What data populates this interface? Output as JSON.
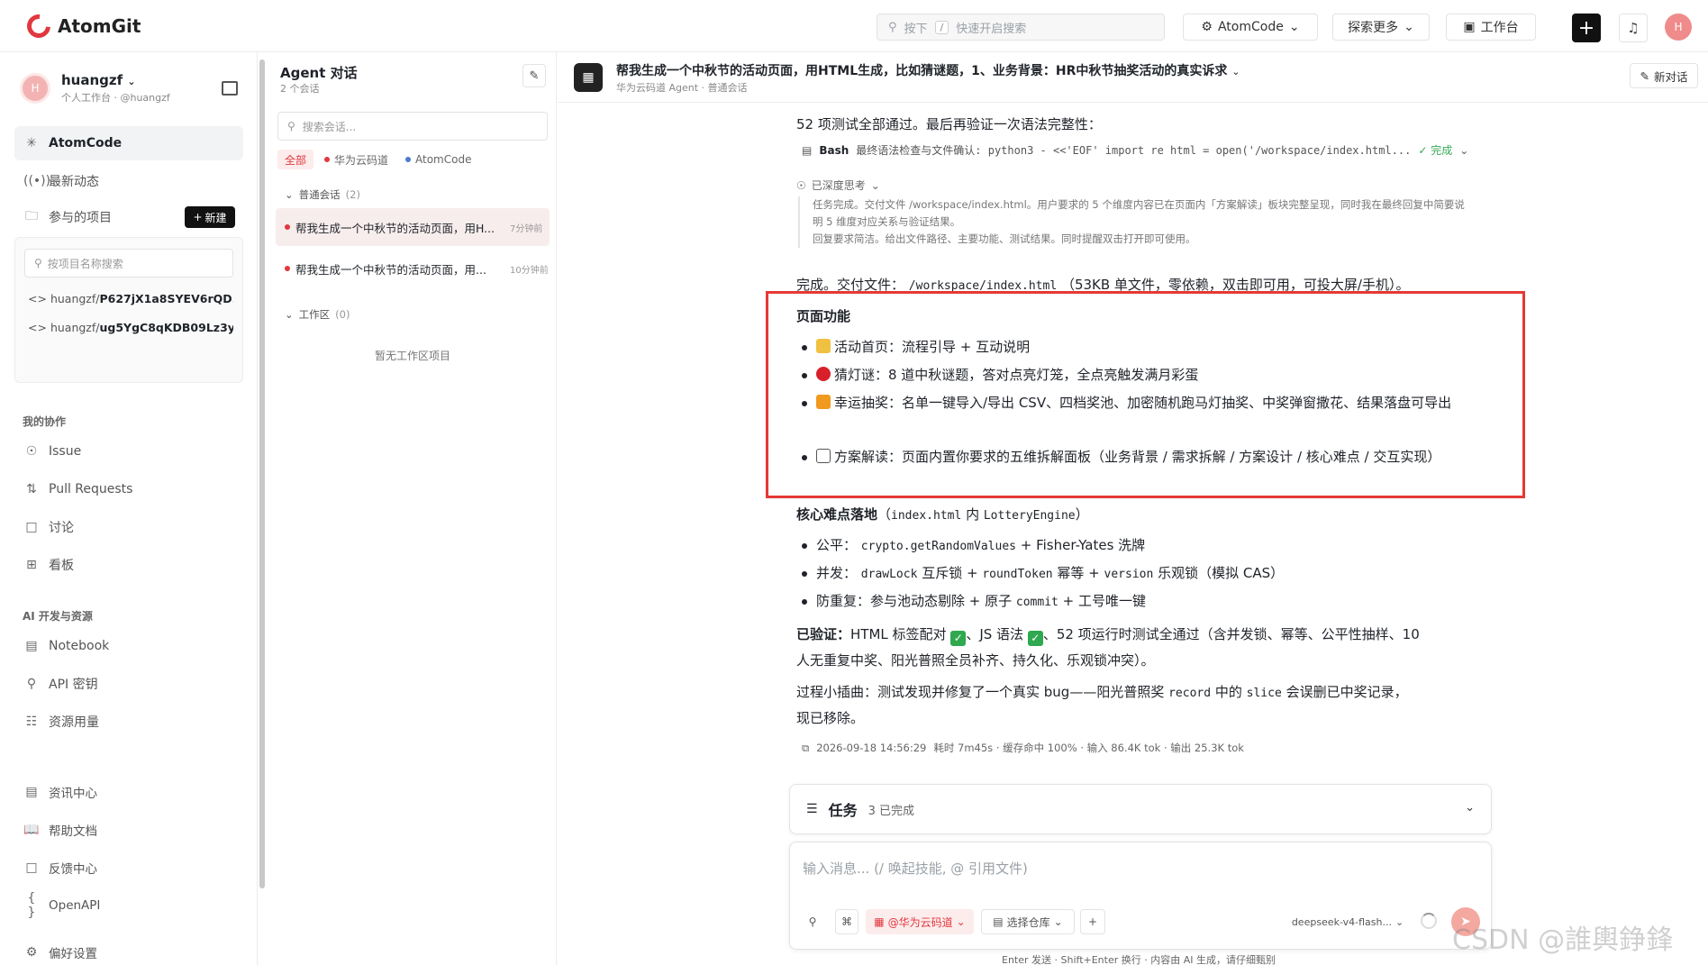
{
  "app": {
    "name": "AtomGit"
  },
  "topbar": {
    "search_placeholder": "快速开启搜索",
    "search_kbd_label": "按下",
    "search_kbd_key": "/",
    "atomcode_label": "AtomCode",
    "explore_label": "探索更多",
    "workbench_label": "工作台",
    "avatar_letter": "H"
  },
  "user": {
    "name": "huangzf",
    "sub": "个人工作台 · @huangzf",
    "avatar_letter": "H"
  },
  "sidebar": {
    "nav": [
      {
        "label": "AtomCode",
        "icon": "atom-icon"
      },
      {
        "label": "最新动态",
        "icon": "radio-icon"
      },
      {
        "label": "参与的项目",
        "icon": "folder-icon"
      }
    ],
    "new_button": "新建",
    "project_search_placeholder": "按项目名称搜索",
    "projects": [
      {
        "owner": "huangzf/",
        "name": "P627jX1a8SYEV6rQD..."
      },
      {
        "owner": "huangzf/",
        "name": "ug5YgC8qKDB09Lz3y..."
      }
    ],
    "section_collab": "我的协作",
    "collab": [
      {
        "label": "Issue",
        "icon": "issue-icon"
      },
      {
        "label": "Pull Requests",
        "icon": "pull-request-icon"
      },
      {
        "label": "讨论",
        "icon": "discussion-icon"
      },
      {
        "label": "看板",
        "icon": "board-icon"
      }
    ],
    "section_ai": "AI 开发与资源",
    "ai": [
      {
        "label": "Notebook",
        "icon": "notebook-icon"
      },
      {
        "label": "API 密钥",
        "icon": "key-icon"
      },
      {
        "label": "资源用量",
        "icon": "database-icon"
      }
    ],
    "bottom": [
      {
        "label": "资讯中心",
        "icon": "news-icon"
      },
      {
        "label": "帮助文档",
        "icon": "book-icon"
      },
      {
        "label": "反馈中心",
        "icon": "feedback-icon"
      },
      {
        "label": "OpenAPI",
        "icon": "braces-icon"
      }
    ],
    "settings": "偏好设置"
  },
  "agent_panel": {
    "title": "Agent 对话",
    "subtitle": "2 个会话",
    "search_placeholder": "搜索会话...",
    "filters": [
      "全部",
      "华为云码道",
      "AtomCode"
    ],
    "group_normal": "普通会话",
    "group_normal_count": "(2)",
    "conversations": [
      {
        "title": "帮我生成一个中秋节的活动页面，用H...",
        "time": "7分钟前"
      },
      {
        "title": "帮我生成一个中秋节的活动页面，用...",
        "time": "10分钟前"
      }
    ],
    "group_workspace": "工作区",
    "group_workspace_count": "(0)",
    "empty_workspace": "暂无工作区项目"
  },
  "chat": {
    "title": "帮我生成一个中秋节的活动页面，用HTML生成，比如猜谜题，1、业务背景：HR中秋节抽奖活动的真实诉求",
    "subtitle": "华为云码道 Agent · 普通会话",
    "new_chat": "新对话",
    "line1": "52 项测试全部通过。最后再验证一次语法完整性：",
    "bash_label": "Bash",
    "bash_text": "最终语法检查与文件确认: python3 - <<'EOF' import re html = open('/workspace/index.html...",
    "bash_status": "✓ 完成",
    "think_label": "已深度思考",
    "think_p1": "任务完成。交付文件 /workspace/index.html。用户要求的 5 个维度内容已在页面内「方案解读」板块完整呈现，同时我在最终回复中简要说明 5 维度对应关系与验证结果。",
    "think_p2": "回复要求简洁。给出文件路径、主要功能、测试结果。同时提醒双击打开即可使用。",
    "done_prefix": "完成。交付文件：",
    "done_path": "/workspace/index.html",
    "done_suffix": "（53KB 单文件，零依赖，双击即可用，可投大屏/手机）。",
    "features_title": "页面功能",
    "features": [
      "活动首页：流程引导 + 互动说明",
      "猜灯谜：8 道中秋谜题，答对点亮灯笼，全点亮触发满月彩蛋",
      "幸运抽奖：名单一键导入/导出 CSV、四档奖池、加密随机跑马灯抽奖、中奖弹窗撒花、结果落盘可导出",
      "方案解读：页面内置你要求的五维拆解面板（业务背景 / 需求拆解 / 方案设计 / 核心难点 / 交互实现）"
    ],
    "core_title": "核心难点落地",
    "core_suffix_a": "（",
    "core_file": "index.html",
    "core_mid": " 内 ",
    "core_engine": "LotteryEngine",
    "core_suffix_b": "）",
    "core_items": [
      {
        "label": "公平：",
        "code": "crypto.getRandomValues",
        "rest": "+ Fisher-Yates 洗牌"
      },
      {
        "label": "并发：",
        "code": "drawLock",
        "rest": "互斥锁 +",
        "code2": "roundToken",
        "rest2": "幂等 +",
        "code3": "version",
        "rest3": "乐观锁（模拟 CAS）"
      },
      {
        "label": "防重复：",
        "plain": "参与池动态剔除 + 原子",
        "code": "commit",
        "rest": "+ 工号唯一键"
      }
    ],
    "verified_title": "已验证：",
    "verified_a": "HTML 标签配对",
    "verified_b": "、JS 语法",
    "verified_c": "、52 项运行时测试全通过（含并发锁、幂等、公平性抽样、10",
    "verified_d": "人无重复中奖、阳光普照全员补齐、持久化、乐观锁冲突）。",
    "bug_a": "过程小插曲：测试发现并修复了一个真实 bug——阳光普照奖",
    "bug_code1": "record",
    "bug_b": "中的",
    "bug_code2": "slice",
    "bug_c": "会误删已中奖记录，",
    "bug_d": "现已移除。",
    "meta": "2026-09-18 14:56:29",
    "meta_stats": "耗时 7m45s · 缓存命中 100% · 输入 86.4K tok · 输出 25.3K tok"
  },
  "tasks": {
    "label": "任务",
    "status": "3 已完成"
  },
  "composer": {
    "placeholder": "输入消息...   (/ 唤起技能, @ 引用文件)",
    "agent_chip": "@华为云码道",
    "repo_chip": "选择仓库",
    "model": "deepseek-v4-flash...",
    "footer": "Enter 发送 · Shift+Enter 换行 · 内容由 AI 生成，请仔细甄别"
  },
  "watermark": "CSDN @誰輿錚鋒",
  "colors": {
    "brand": "#e0383e",
    "highlight_box": "#e53935",
    "check": "#2fa84f"
  }
}
